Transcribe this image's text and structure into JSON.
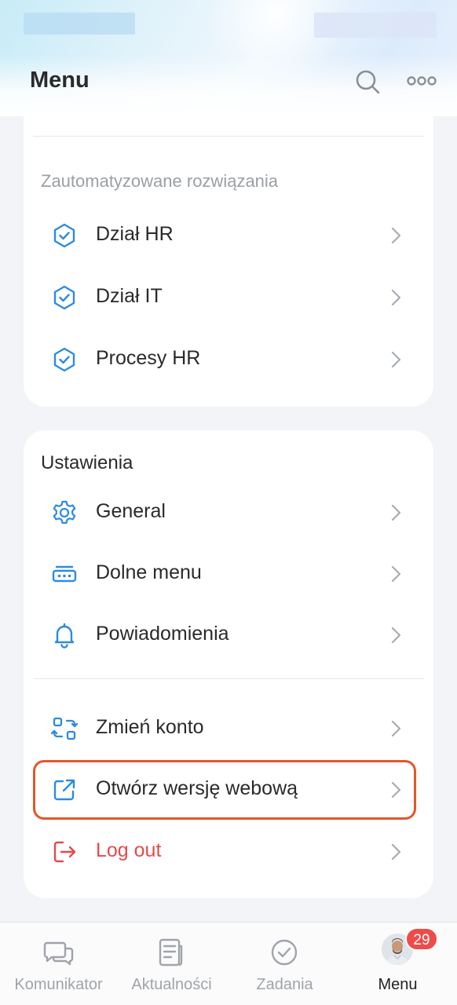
{
  "header": {
    "title": "Menu"
  },
  "automated": {
    "section_title": "Zautomatyzowane rozwiązania",
    "items": [
      {
        "label": "Dział HR",
        "icon": "shield-check-icon"
      },
      {
        "label": "Dział IT",
        "icon": "shield-check-icon"
      },
      {
        "label": "Procesy HR",
        "icon": "shield-check-icon"
      }
    ]
  },
  "settings": {
    "section_title": "Ustawienia",
    "items": [
      {
        "label": "General",
        "icon": "gear-icon"
      },
      {
        "label": "Dolne menu",
        "icon": "bottom-menu-icon"
      },
      {
        "label": "Powiadomienia",
        "icon": "bell-icon"
      },
      {
        "label": "Zmień konto",
        "icon": "switch-account-icon"
      },
      {
        "label": "Otwórz wersję webową",
        "icon": "external-link-icon"
      },
      {
        "label": "Log out",
        "icon": "logout-icon"
      }
    ]
  },
  "bottom_nav": {
    "items": [
      {
        "label": "Komunikator",
        "icon": "chat-icon"
      },
      {
        "label": "Aktualności",
        "icon": "news-icon"
      },
      {
        "label": "Zadania",
        "icon": "check-circle-icon"
      },
      {
        "label": "Menu",
        "icon": "avatar",
        "active": true
      }
    ],
    "badge": "29"
  },
  "colors": {
    "accent": "#2d8be0",
    "danger": "#e64a4a",
    "highlight": "#e2572b",
    "badge": "#ef4b4b"
  }
}
